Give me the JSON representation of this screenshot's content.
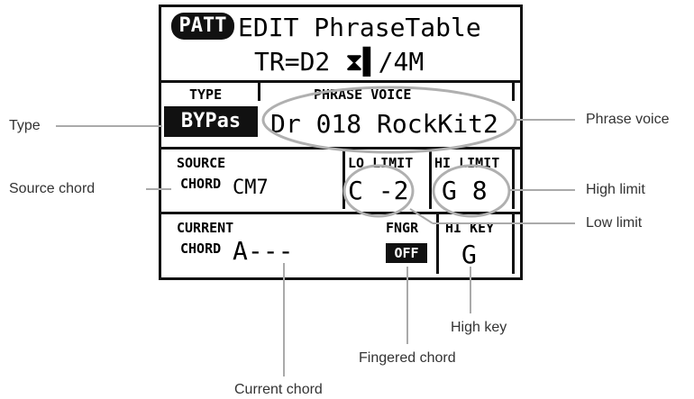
{
  "display": {
    "mode_badge": "PATT",
    "title": "EDIT PhraseTable",
    "track_line": "TR=D2 ⧗▌/4M",
    "type_header": "TYPE",
    "type_value": "BYPas",
    "phrase_voice_header": "PHRASE VOICE",
    "phrase_voice_value": "Dr 018 RockKit2",
    "source_header": "SOURCE",
    "source_label": "CHORD",
    "source_value": "CM7",
    "lo_limit_header": "LO LIMIT",
    "hi_limit_header": "HI LIMIT",
    "lo_limit_value": "C -2",
    "hi_limit_value": "G 8",
    "current_header": "CURRENT",
    "current_label": "CHORD",
    "current_value": "A---",
    "fngr_header": "FNGR",
    "fngr_value": "OFF",
    "hikey_header": "HI KEY",
    "hikey_value": "G"
  },
  "callouts": {
    "type": "Type",
    "source_chord": "Source chord",
    "phrase_voice": "Phrase voice",
    "high_limit": "High limit",
    "low_limit": "Low limit",
    "high_key": "High key",
    "fingered_chord": "Fingered chord",
    "current_chord": "Current chord"
  },
  "colors": {
    "ink": "#111111",
    "callout_line": "#aaaaaa",
    "ellipse": "#b0b0b0"
  }
}
